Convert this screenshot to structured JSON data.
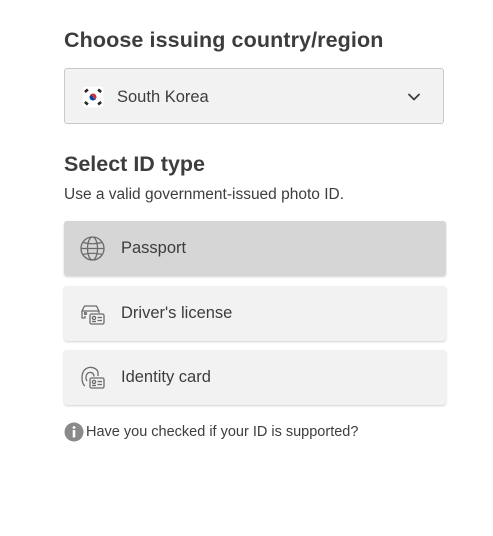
{
  "country_section": {
    "heading": "Choose issuing country/region",
    "selected_country": "South Korea",
    "flag_icon": "south-korea-flag-icon",
    "chevron_icon": "chevron-down-icon"
  },
  "id_section": {
    "heading": "Select ID type",
    "subtitle": "Use a valid government-issued photo ID.",
    "options": [
      {
        "label": "Passport",
        "icon": "globe-icon",
        "selected": true
      },
      {
        "label": "Driver's license",
        "icon": "car-id-icon",
        "selected": false
      },
      {
        "label": "Identity card",
        "icon": "id-card-icon",
        "selected": false
      }
    ]
  },
  "help": {
    "text": "Have you checked if your ID is supported?",
    "icon": "info-icon"
  },
  "colors": {
    "text": "#3d3d3d",
    "option_bg": "#f2f2f2",
    "option_selected_bg": "#d6d6d6",
    "border": "#c9c9c9",
    "icon_gray": "#6b6b6b"
  }
}
